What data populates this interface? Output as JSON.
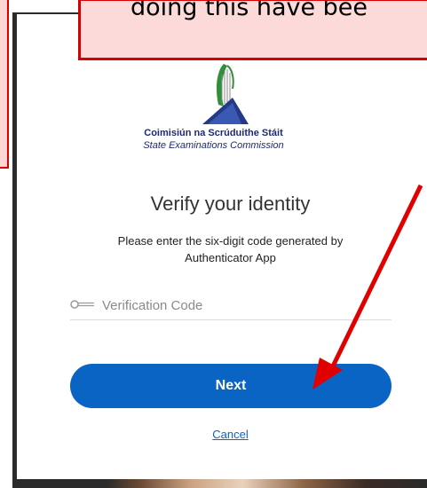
{
  "callout": {
    "text": "doing this have bee"
  },
  "organization": {
    "name_irish": "Coimisiún na Scrúduithe Stáit",
    "name_english": "State Examinations Commission"
  },
  "verify": {
    "title": "Verify your identity",
    "instruction": "Please enter the six-digit code generated by Authenticator App",
    "code_placeholder": "Verification Code",
    "next_label": "Next",
    "cancel_label": "Cancel"
  },
  "colors": {
    "primary_blue": "#0a64c4",
    "annotation_red": "#d60000",
    "annotation_fill": "#fcdada",
    "brand_navy": "#1d2a72"
  },
  "icons": {
    "key": "key-icon",
    "logo": "harp-logo"
  }
}
